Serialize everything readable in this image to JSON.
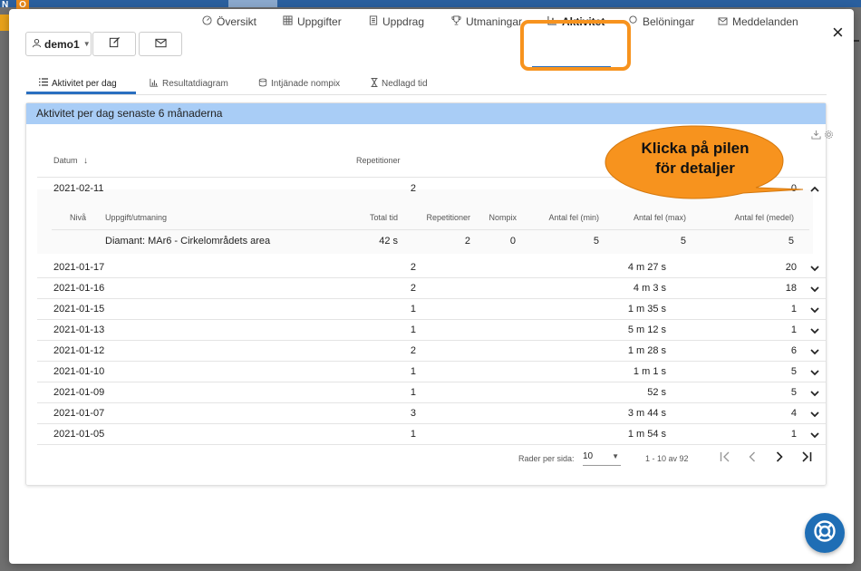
{
  "background": {
    "logo_n": "N",
    "logo_o": "O"
  },
  "header": {
    "user_label": "demo1",
    "close_label": "×"
  },
  "main_tabs": [
    {
      "label": "Översikt",
      "icon": "gauge-icon"
    },
    {
      "label": "Uppgifter",
      "icon": "grid-icon"
    },
    {
      "label": "Uppdrag",
      "icon": "document-icon"
    },
    {
      "label": "Utmaningar",
      "icon": "trophy-icon"
    },
    {
      "label": "Aktivitet",
      "icon": "bar-chart-icon",
      "active": true
    },
    {
      "label": "Belöningar",
      "icon": "badge-icon"
    },
    {
      "label": "Meddelanden",
      "icon": "envelope-icon"
    }
  ],
  "sub_tabs": [
    {
      "label": "Aktivitet per dag",
      "icon": "list-icon",
      "active": true
    },
    {
      "label": "Resultatdiagram",
      "icon": "bar-chart-icon"
    },
    {
      "label": "Intjänade nompix",
      "icon": "coins-icon"
    },
    {
      "label": "Nedlagd tid",
      "icon": "hourglass-icon"
    }
  ],
  "card": {
    "title": "Aktivitet per dag senaste 6 månaderna",
    "columns": {
      "datum": "Datum",
      "repetitioner": "Repetitioner"
    }
  },
  "rows": [
    {
      "date": "2021-02-11",
      "reps": "2",
      "time": "42 s",
      "errors": "0",
      "expanded": true
    },
    {
      "date": "2021-01-17",
      "reps": "2",
      "time": "4 m 27 s",
      "errors": "20"
    },
    {
      "date": "2021-01-16",
      "reps": "2",
      "time": "4 m 3 s",
      "errors": "18"
    },
    {
      "date": "2021-01-15",
      "reps": "1",
      "time": "1 m 35 s",
      "errors": "1"
    },
    {
      "date": "2021-01-13",
      "reps": "1",
      "time": "5 m 12 s",
      "errors": "1"
    },
    {
      "date": "2021-01-12",
      "reps": "2",
      "time": "1 m 28 s",
      "errors": "6"
    },
    {
      "date": "2021-01-10",
      "reps": "1",
      "time": "1 m 1 s",
      "errors": "5"
    },
    {
      "date": "2021-01-09",
      "reps": "1",
      "time": "52 s",
      "errors": "5"
    },
    {
      "date": "2021-01-07",
      "reps": "3",
      "time": "3 m 44 s",
      "errors": "4"
    },
    {
      "date": "2021-01-05",
      "reps": "1",
      "time": "1 m 54 s",
      "errors": "1"
    }
  ],
  "detail": {
    "headers": [
      "Nivå",
      "Uppgift/utmaning",
      "Total tid",
      "Repetitioner",
      "Nompix",
      "Antal fel (min)",
      "Antal fel (max)",
      "Antal fel (medel)"
    ],
    "row": {
      "task": "Diamant: MAr6 - Cirkelområdets area",
      "total_time": "42 s",
      "reps": "2",
      "nompix": "0",
      "min": "5",
      "max": "5",
      "avg": "5"
    }
  },
  "pagination": {
    "rows_per_page_label": "Rader per sida:",
    "rows_per_page_value": "10",
    "range": "1 - 10 av 92"
  },
  "callout": {
    "line1": "Klicka på pilen",
    "line2": "för detaljer"
  },
  "colors": {
    "accent": "#2a6fc0",
    "highlight": "#f7931e",
    "header_bg": "#a9cdf6",
    "callout_bg": "#f7931e"
  }
}
